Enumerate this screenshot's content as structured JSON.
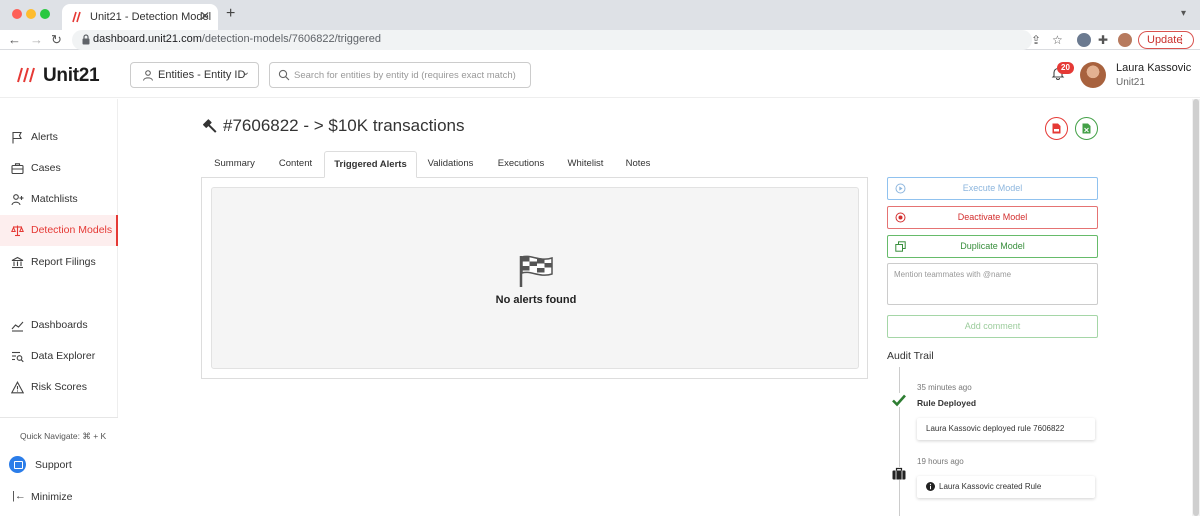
{
  "browser": {
    "tab_title": "Unit21 - Detection Model",
    "url_host": "dashboard.unit21.com",
    "url_path": "/detection-models/7606822/triggered",
    "update_label": "Update"
  },
  "header": {
    "logo_text": "Unit21",
    "entity_select_label": "Entities - Entity ID",
    "search_placeholder": "Search for entities by entity id (requires exact match)",
    "notification_count": "20",
    "user_name": "Laura Kassovic",
    "user_org": "Unit21"
  },
  "sidebar": {
    "items": [
      {
        "label": "Alerts",
        "icon": "flag-icon"
      },
      {
        "label": "Cases",
        "icon": "briefcase-icon"
      },
      {
        "label": "Matchlists",
        "icon": "user-add-icon"
      },
      {
        "label": "Detection Models",
        "icon": "scale-icon",
        "active": true
      },
      {
        "label": "Report Filings",
        "icon": "bank-icon"
      },
      {
        "label": "Dashboards",
        "icon": "chart-icon"
      },
      {
        "label": "Data Explorer",
        "icon": "data-search-icon"
      },
      {
        "label": "Risk Scores",
        "icon": "warning-icon"
      }
    ],
    "quick_navigate": "Quick Navigate: ⌘ + K",
    "support_label": "Support",
    "minimize_label": "Minimize"
  },
  "page": {
    "title": "#7606822 - > $10K transactions",
    "tabs": [
      {
        "label": "Summary"
      },
      {
        "label": "Content"
      },
      {
        "label": "Triggered Alerts",
        "active": true
      },
      {
        "label": "Validations"
      },
      {
        "label": "Executions"
      },
      {
        "label": "Whitelist"
      },
      {
        "label": "Notes"
      }
    ],
    "empty_message": "No alerts found"
  },
  "actions": {
    "execute_label": "Execute Model",
    "deactivate_label": "Deactivate Model",
    "duplicate_label": "Duplicate Model",
    "comment_placeholder": "Mention teammates with @name",
    "add_comment_label": "Add comment"
  },
  "audit": {
    "title": "Audit Trail",
    "entries": [
      {
        "time": "35 minutes ago",
        "event": "Rule Deployed",
        "detail": "Laura Kassovic deployed rule 7606822",
        "icon": "check-icon"
      },
      {
        "time": "19 hours ago",
        "event": "",
        "detail": "Laura Kassovic created Rule",
        "icon": "briefcase-icon"
      }
    ]
  },
  "colors": {
    "brand_red": "#e53935",
    "active_bg": "#fdeeee",
    "success_green": "#388e3c",
    "info_blue": "#8db6de"
  }
}
